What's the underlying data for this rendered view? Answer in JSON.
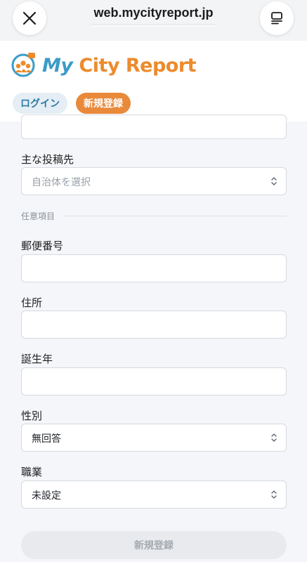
{
  "browser": {
    "url": "web.mycityreport.jp"
  },
  "site": {
    "logo_my": "My",
    "logo_rest": "City Report",
    "login_label": "ログイン",
    "signup_label": "新規登録"
  },
  "form": {
    "main_post_label": "主な投稿先",
    "main_post_placeholder": "自治体を選択",
    "optional_section": "任意項目",
    "postal_label": "郵便番号",
    "address_label": "住所",
    "birth_year_label": "誕生年",
    "gender_label": "性別",
    "gender_value": "無回答",
    "occupation_label": "職業",
    "occupation_value": "未設定",
    "submit_label": "新規登録"
  },
  "colors": {
    "brand_blue": "#3a9cc8",
    "brand_orange": "#ec8b2c"
  }
}
